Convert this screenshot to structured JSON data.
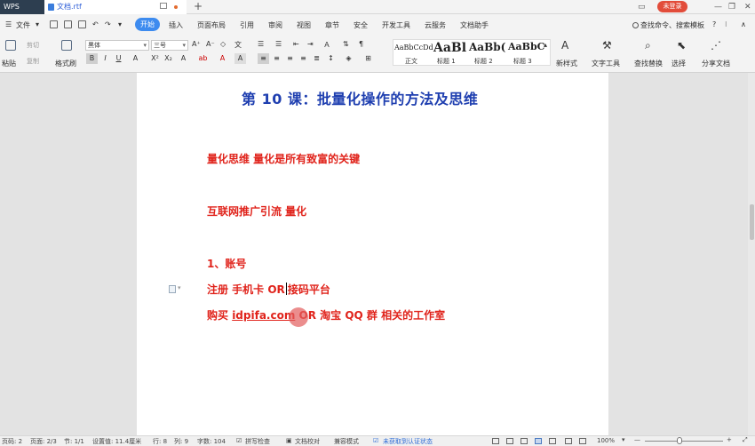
{
  "app": {
    "name": "WPS",
    "doc_tab": "文档.rtf",
    "login": "未登录"
  },
  "menu": {
    "file": "文件",
    "tabs": [
      "开始",
      "插入",
      "页面布局",
      "引用",
      "审阅",
      "视图",
      "章节",
      "安全",
      "开发工具",
      "云服务",
      "文档助手"
    ],
    "search": "查找命令、搜索模板"
  },
  "ribbon": {
    "paste": "粘贴",
    "cut": "剪切",
    "copy": "复制",
    "format_painter": "格式刷",
    "font_name": "黑体",
    "font_size": "三号",
    "styles": [
      {
        "sample": "AaBbCcDd",
        "name": "正文"
      },
      {
        "sample": "AaBl",
        "name": "标题 1"
      },
      {
        "sample": "AaBb(",
        "name": "标题 2"
      },
      {
        "sample": "AaBbC",
        "name": "标题 3"
      }
    ],
    "new_style": "新样式",
    "text_tools": "文字工具",
    "find_replace": "查找替换",
    "select": "选择",
    "share_doc": "分享文档"
  },
  "document": {
    "title": "第 10 课：批量化操作的方法及思维",
    "lines": [
      "量化思维   量化是所有致富的关键",
      "互联网推广引流  量化",
      "1、账号"
    ],
    "register_pre": "注册 手机卡 OR",
    "register_post": "接码平台",
    "buy_pre": "购买 ",
    "buy_url": "idpifa.com",
    "buy_post": " OR 淘宝  QQ 群  相关的工作室"
  },
  "status": {
    "page_num": "页码: 2",
    "pages": "页面: 2/3",
    "section": "节: 1/1",
    "setting": "设置值: 11.4厘米",
    "row": "行: 8",
    "col": "列: 9",
    "words": "字数: 104",
    "spell": "拼写检查",
    "proof": "文档校对",
    "compat": "兼容模式",
    "auth": "未获取到认证状态",
    "zoom": "100%"
  }
}
